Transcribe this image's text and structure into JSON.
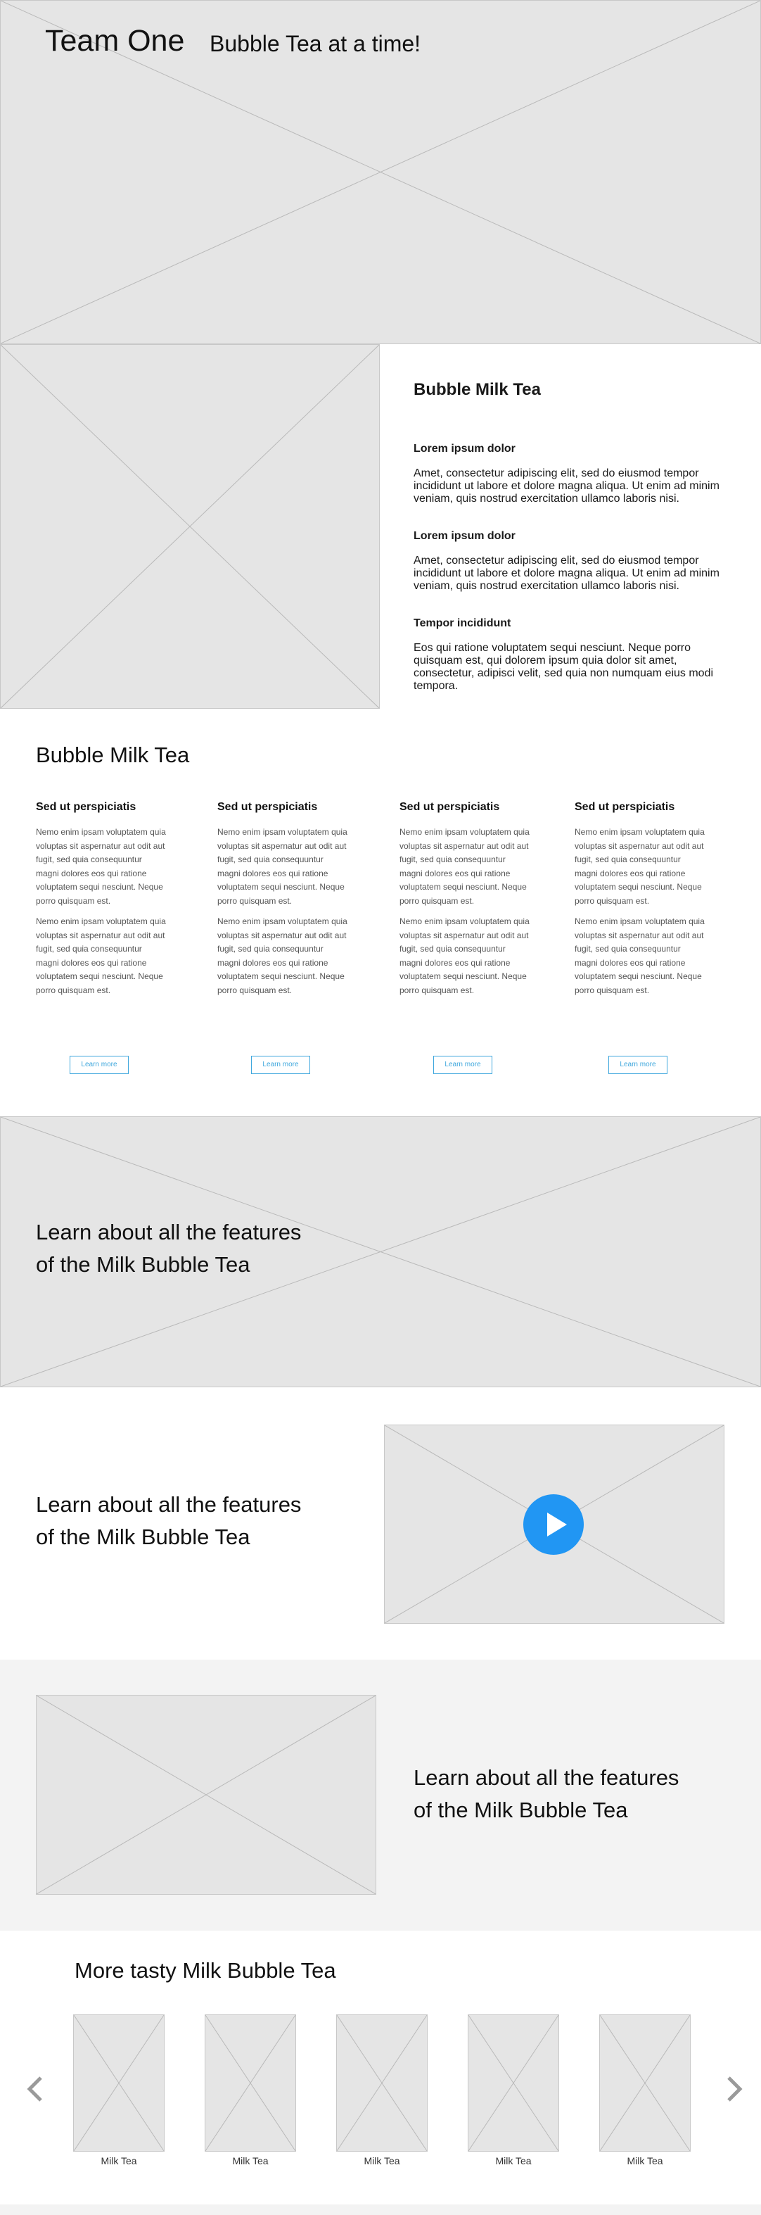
{
  "hero": {
    "title": "Team One",
    "tagline": "Bubble Tea at a time!"
  },
  "feature": {
    "title": "Bubble Milk Tea",
    "items": [
      {
        "heading": "Lorem ipsum dolor",
        "text": "Amet, consectetur adipiscing elit, sed do eiusmod tempor incididunt ut labore et dolore magna aliqua. Ut enim ad minim veniam, quis nostrud exercitation ullamco laboris nisi."
      },
      {
        "heading": "Lorem ipsum dolor",
        "text": "Amet, consectetur adipiscing elit, sed do eiusmod tempor incididunt ut labore et dolore magna aliqua. Ut enim ad minim veniam, quis nostrud exercitation ullamco laboris nisi."
      },
      {
        "heading": "Tempor incididunt",
        "text": "Eos qui ratione voluptatem sequi nesciunt. Neque porro quisquam est, qui dolorem ipsum quia dolor sit amet, consectetur, adipisci velit, sed quia non numquam eius modi tempora."
      }
    ]
  },
  "columns_section": {
    "title": "Bubble Milk Tea",
    "columns": [
      {
        "heading": "Sed ut perspiciatis",
        "p1": "Nemo enim ipsam voluptatem quia voluptas sit aspernatur aut odit aut fugit, sed quia consequuntur magni dolores eos qui ratione voluptatem sequi nesciunt. Neque porro quisquam est.",
        "p2": "Nemo enim ipsam voluptatem quia voluptas sit aspernatur aut odit aut fugit, sed quia consequuntur magni dolores eos qui ratione voluptatem sequi nesciunt. Neque porro quisquam est.",
        "button": "Learn more"
      },
      {
        "heading": "Sed ut perspiciatis",
        "p1": "Nemo enim ipsam voluptatem quia voluptas sit aspernatur aut odit aut fugit, sed quia consequuntur magni dolores eos qui ratione voluptatem sequi nesciunt. Neque porro quisquam est.",
        "p2": "Nemo enim ipsam voluptatem quia voluptas sit aspernatur aut odit aut fugit, sed quia consequuntur magni dolores eos qui ratione voluptatem sequi nesciunt. Neque porro quisquam est.",
        "button": "Learn more"
      },
      {
        "heading": "Sed ut perspiciatis",
        "p1": "Nemo enim ipsam voluptatem quia voluptas sit aspernatur aut odit aut fugit, sed quia consequuntur magni dolores eos qui ratione voluptatem sequi nesciunt. Neque porro quisquam est.",
        "p2": "Nemo enim ipsam voluptatem quia voluptas sit aspernatur aut odit aut fugit, sed quia consequuntur magni dolores eos qui ratione voluptatem sequi nesciunt. Neque porro quisquam est.",
        "button": "Learn more"
      },
      {
        "heading": "Sed ut perspiciatis",
        "p1": "Nemo enim ipsam voluptatem quia voluptas sit aspernatur aut odit aut fugit, sed quia consequuntur magni dolores eos qui ratione voluptatem sequi nesciunt. Neque porro quisquam est.",
        "p2": "Nemo enim ipsam voluptatem quia voluptas sit aspernatur aut odit aut fugit, sed quia consequuntur magni dolores eos qui ratione voluptatem sequi nesciunt. Neque porro quisquam est.",
        "button": "Learn more"
      }
    ]
  },
  "banner": {
    "line1": "Learn about all the features",
    "line2": "of the Milk Bubble Tea"
  },
  "video_section": {
    "line1": "Learn about all the features",
    "line2": "of the Milk Bubble Tea",
    "play_icon": "play-icon",
    "accent_color": "#2196f3"
  },
  "image_section": {
    "line1": "Learn about all the features",
    "line2": "of the Milk Bubble Tea"
  },
  "carousel": {
    "title": "More tasty Milk Bubble Tea",
    "prev_icon": "chevron-left-icon",
    "next_icon": "chevron-right-icon",
    "items": [
      {
        "label": "Milk Tea"
      },
      {
        "label": "Milk Tea"
      },
      {
        "label": "Milk Tea"
      },
      {
        "label": "Milk Tea"
      },
      {
        "label": "Milk Tea"
      }
    ]
  }
}
